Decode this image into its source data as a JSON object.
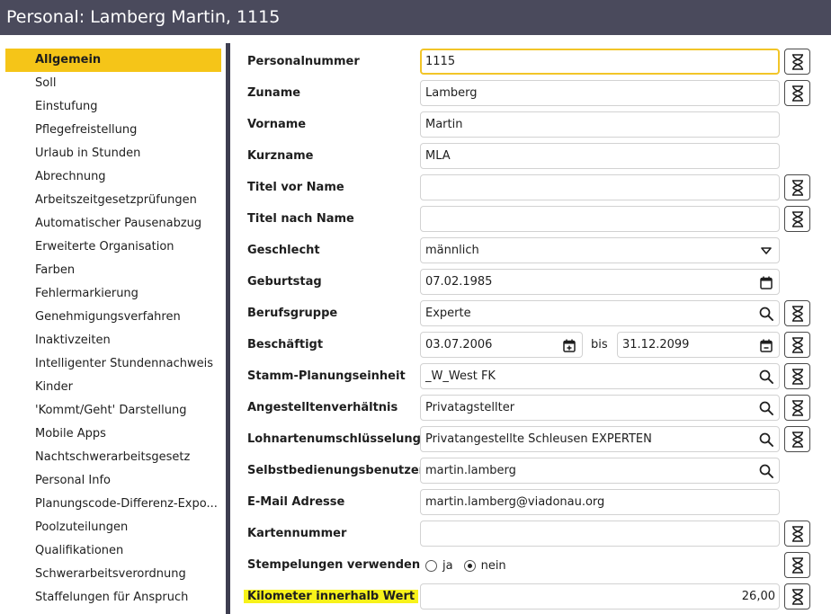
{
  "window": {
    "title": "Personal: Lamberg Martin, 1115"
  },
  "sidebar": {
    "items": [
      {
        "label": "Allgemein",
        "active": true
      },
      {
        "label": "Soll"
      },
      {
        "label": "Einstufung"
      },
      {
        "label": "Pflegefreistellung"
      },
      {
        "label": "Urlaub in Stunden"
      },
      {
        "label": "Abrechnung"
      },
      {
        "label": "Arbeitszeitgesetzprüfungen"
      },
      {
        "label": "Automatischer Pausenabzug"
      },
      {
        "label": "Erweiterte Organisation"
      },
      {
        "label": "Farben"
      },
      {
        "label": "Fehlermarkierung"
      },
      {
        "label": "Genehmigungsverfahren"
      },
      {
        "label": "Inaktivzeiten"
      },
      {
        "label": "Intelligenter Stundennachweis"
      },
      {
        "label": "Kinder"
      },
      {
        "label": "'Kommt/Geht' Darstellung"
      },
      {
        "label": "Mobile Apps"
      },
      {
        "label": "Nachtschwerarbeitsgesetz"
      },
      {
        "label": "Personal Info"
      },
      {
        "label": "Planungscode-Differenz-Expo..."
      },
      {
        "label": "Poolzuteilungen"
      },
      {
        "label": "Qualifikationen"
      },
      {
        "label": "Schwerarbeitsverordnung"
      },
      {
        "label": "Staffelungen für Anspruch"
      }
    ]
  },
  "form": {
    "personalnummer": {
      "label": "Personalnummer",
      "value": "1115"
    },
    "zuname": {
      "label": "Zuname",
      "value": "Lamberg"
    },
    "vorname": {
      "label": "Vorname",
      "value": "Martin"
    },
    "kurzname": {
      "label": "Kurzname",
      "value": "MLA"
    },
    "titel_vor": {
      "label": "Titel vor Name",
      "value": ""
    },
    "titel_nach": {
      "label": "Titel nach Name",
      "value": ""
    },
    "geschlecht": {
      "label": "Geschlecht",
      "value": "männlich"
    },
    "geburtstag": {
      "label": "Geburtstag",
      "value": "07.02.1985"
    },
    "berufsgruppe": {
      "label": "Berufsgruppe",
      "value": "Experte"
    },
    "beschaeftigt": {
      "label": "Beschäftigt",
      "from": "03.07.2006",
      "bis_label": "bis",
      "to": "31.12.2099"
    },
    "stamm_planung": {
      "label": "Stamm-Planungseinheit",
      "value": "_W_West FK"
    },
    "angestellten": {
      "label": "Angestelltenverhältnis",
      "value": "Privatagstellter"
    },
    "lohnarten": {
      "label": "Lohnartenumschlüsselung",
      "value": "Privatangestellte Schleusen EXPERTEN"
    },
    "selbstbedienung": {
      "label": "Selbstbedienungsbenutzer",
      "value": "martin.lamberg"
    },
    "email": {
      "label": "E-Mail Adresse",
      "value": "martin.lamberg@viadonau.org"
    },
    "kartennummer": {
      "label": "Kartennummer",
      "value": ""
    },
    "stempelungen": {
      "label": "Stempelungen verwenden",
      "option_ja": "ja",
      "option_nein": "nein",
      "selected": "nein"
    },
    "kilometer": {
      "label": "Kilometer innerhalb Wert",
      "value": "26,00"
    }
  },
  "colors": {
    "titlebar": "#4a4a5c",
    "active_item": "#f5c518",
    "highlight": "#f7f21a",
    "focus_border": "#f2c528"
  }
}
